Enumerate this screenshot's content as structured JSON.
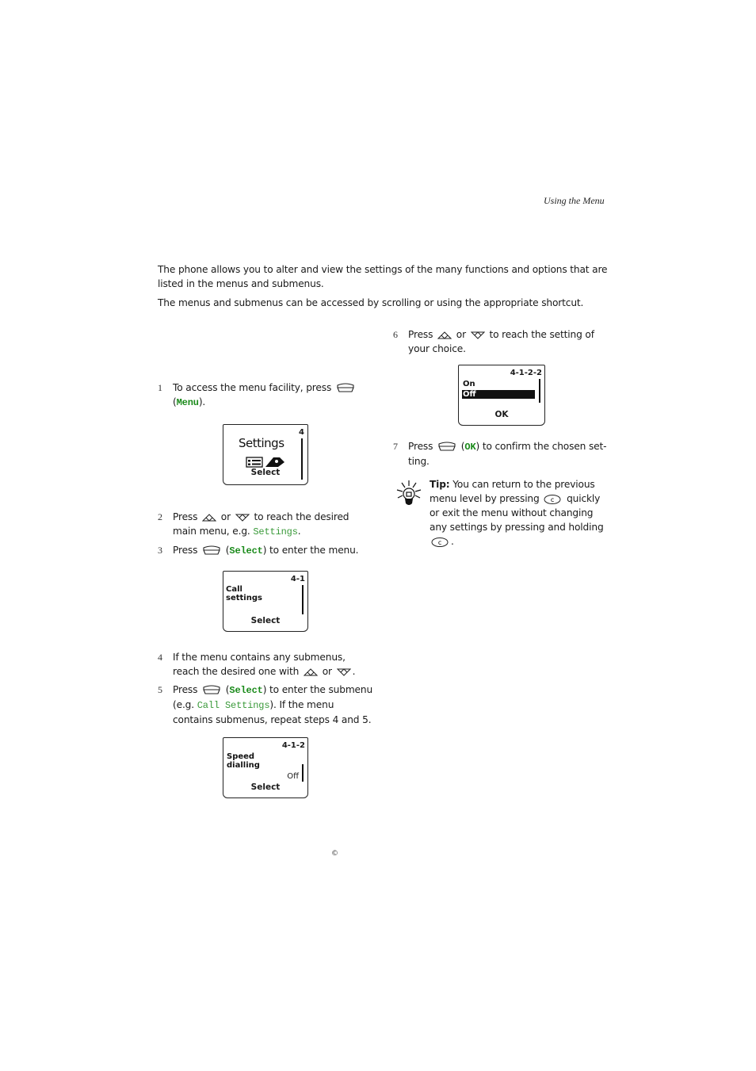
{
  "running_head": "Using the Menu",
  "intro": {
    "p1": "The phone allows you to alter and view the settings of the many functions and options that are listed in the menus and submenus.",
    "p2": "The menus and submenus can be accessed by scrolling or using the appropriate shortcut."
  },
  "keys": {
    "menu": "Menu",
    "select": "Select",
    "ok": "OK",
    "settings": "Settings",
    "call_settings": "Call Settings"
  },
  "steps": [
    {
      "num": "1",
      "a": "To access the menu facility, press",
      "b": "(",
      "c": ")."
    },
    {
      "num": "2",
      "a": "Press",
      "or": "or",
      "b": "to reach the desired main menu, e.g.",
      "c": "."
    },
    {
      "num": "3",
      "a": "Press",
      "b": "(",
      "c": ") to enter the menu."
    },
    {
      "num": "4",
      "a": "If the menu contains any submenus, reach the desired one with",
      "or": "or",
      "c": "."
    },
    {
      "num": "5",
      "a": "Press",
      "b": "(",
      "c": ") to enter the submenu (e.g.",
      "d": "). If the menu contains submenus, repeat steps 4 and 5."
    },
    {
      "num": "6",
      "a": "Press",
      "or": "or",
      "b": "to reach the setting of your choice."
    },
    {
      "num": "7",
      "a": "Press",
      "b": "(",
      "c": ") to confirm the chosen set-ting."
    }
  ],
  "screens": {
    "s1": {
      "title": "Settings",
      "path": "4",
      "soft": "Select"
    },
    "s2": {
      "line1": "Call",
      "line2": "settings",
      "path": "4-1",
      "soft": "Select"
    },
    "s3": {
      "line1": "Speed",
      "line2": "dialling",
      "path": "4-1-2",
      "value": "Off",
      "soft": "Select"
    },
    "s4": {
      "opt1": "On",
      "opt2": "Off",
      "path": "4-1-2-2",
      "soft": "OK"
    }
  },
  "tip": {
    "label": "Tip:",
    "a": "You can return to the previous menu level by pressing",
    "b": "quickly or exit the menu without changing any settings by pressing and holding",
    "c": "."
  },
  "footer": {
    "copyright": "©"
  },
  "colors": {
    "keyword": "#1a8a1a",
    "keyword_light": "#3a9a3a"
  }
}
